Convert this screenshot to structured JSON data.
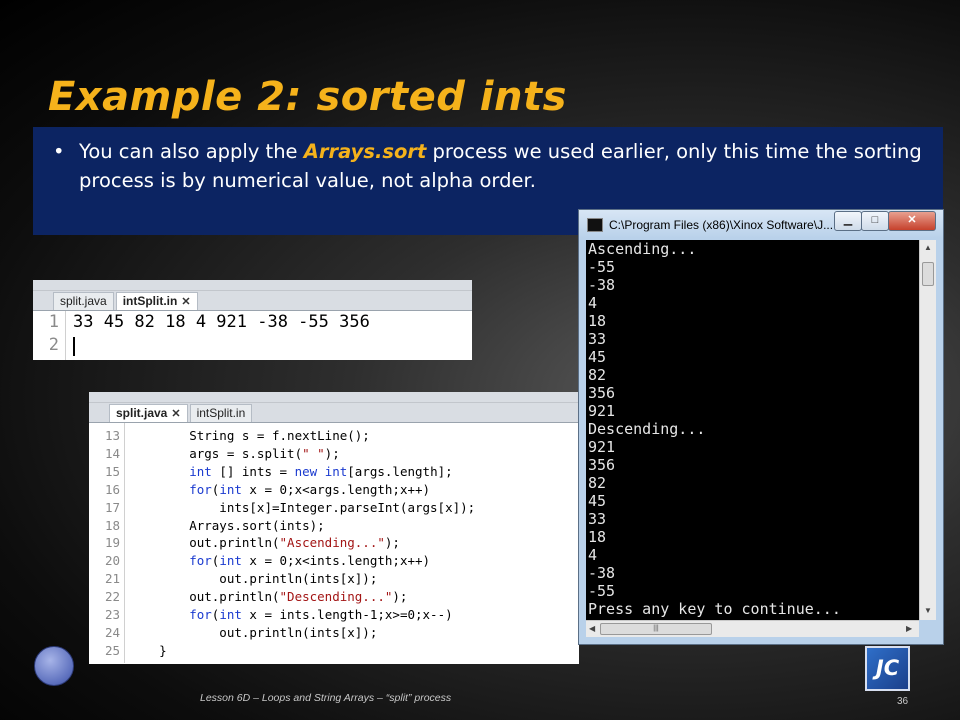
{
  "slide": {
    "title": "Example 2:  sorted ints",
    "bullet_dot": "•",
    "bullet_pre": "You can also apply the ",
    "bullet_em": "Arrays.sort",
    "bullet_post": " process we used earlier, only this time the sorting process is by numerical value, not alpha order.",
    "footer": "Lesson 6D – Loops and String Arrays – “split” process",
    "page_number": "36",
    "logo_text": "JC"
  },
  "editor_top": {
    "tabs": [
      {
        "label": "split.java",
        "active": false
      },
      {
        "label": "intSplit.in",
        "active": true,
        "close": "✕"
      }
    ],
    "lines": [
      {
        "num": "1",
        "text": "33 45 82 18 4 921 -38 -55 356"
      },
      {
        "num": "2",
        "text": ""
      }
    ]
  },
  "editor_bottom": {
    "tabs": [
      {
        "label": "split.java",
        "active": true,
        "close": "✕"
      },
      {
        "label": "intSplit.in",
        "active": false
      }
    ],
    "line_numbers": [
      "13",
      "14",
      "15",
      "16",
      "17",
      "18",
      "19",
      "20",
      "21",
      "22",
      "23",
      "24",
      "25"
    ]
  },
  "console": {
    "title": "C:\\Program Files (x86)\\Xinox Software\\J...",
    "buttons": {
      "minimize": "▁",
      "maximize": "□",
      "close": "✕"
    },
    "lines": [
      "Ascending...",
      "-55",
      "-38",
      "4",
      "18",
      "33",
      "45",
      "82",
      "356",
      "921",
      "Descending...",
      "921",
      "356",
      "82",
      "45",
      "33",
      "18",
      "4",
      "-38",
      "-55",
      "Press any key to continue..."
    ]
  },
  "colors": {
    "title": "#f5b21b",
    "bullet_box": "#0c2462",
    "keyword": "#1a3acf",
    "string": "#a31515"
  }
}
